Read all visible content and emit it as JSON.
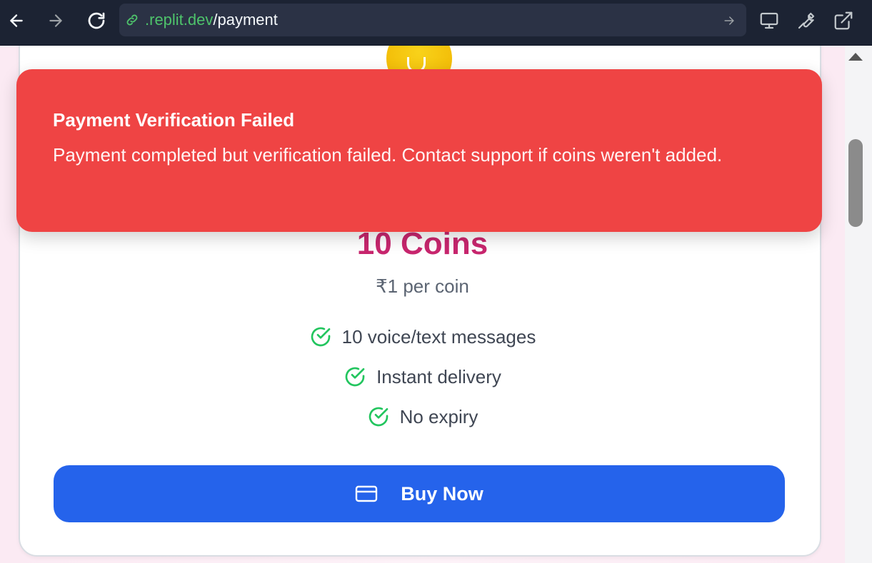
{
  "browser": {
    "url_domain": ".replit.dev",
    "url_path": "/payment",
    "icons": [
      "back-icon",
      "forward-icon",
      "reload-icon",
      "link-icon",
      "go-icon",
      "devices-icon",
      "wrench-icon",
      "external-link-icon"
    ]
  },
  "toast": {
    "title": "Payment Verification Failed",
    "message": "Payment completed but verification failed. Contact support if coins weren't added.",
    "color": "#ef4444"
  },
  "product": {
    "title": "10 Coins",
    "price_note": "₹1 per coin",
    "features": [
      "10 voice/text messages",
      "Instant delivery",
      "No expiry"
    ],
    "buy_label": "Buy Now"
  },
  "colors": {
    "accent": "#2563eb",
    "title": "#c8266e",
    "check": "#22c55e"
  }
}
